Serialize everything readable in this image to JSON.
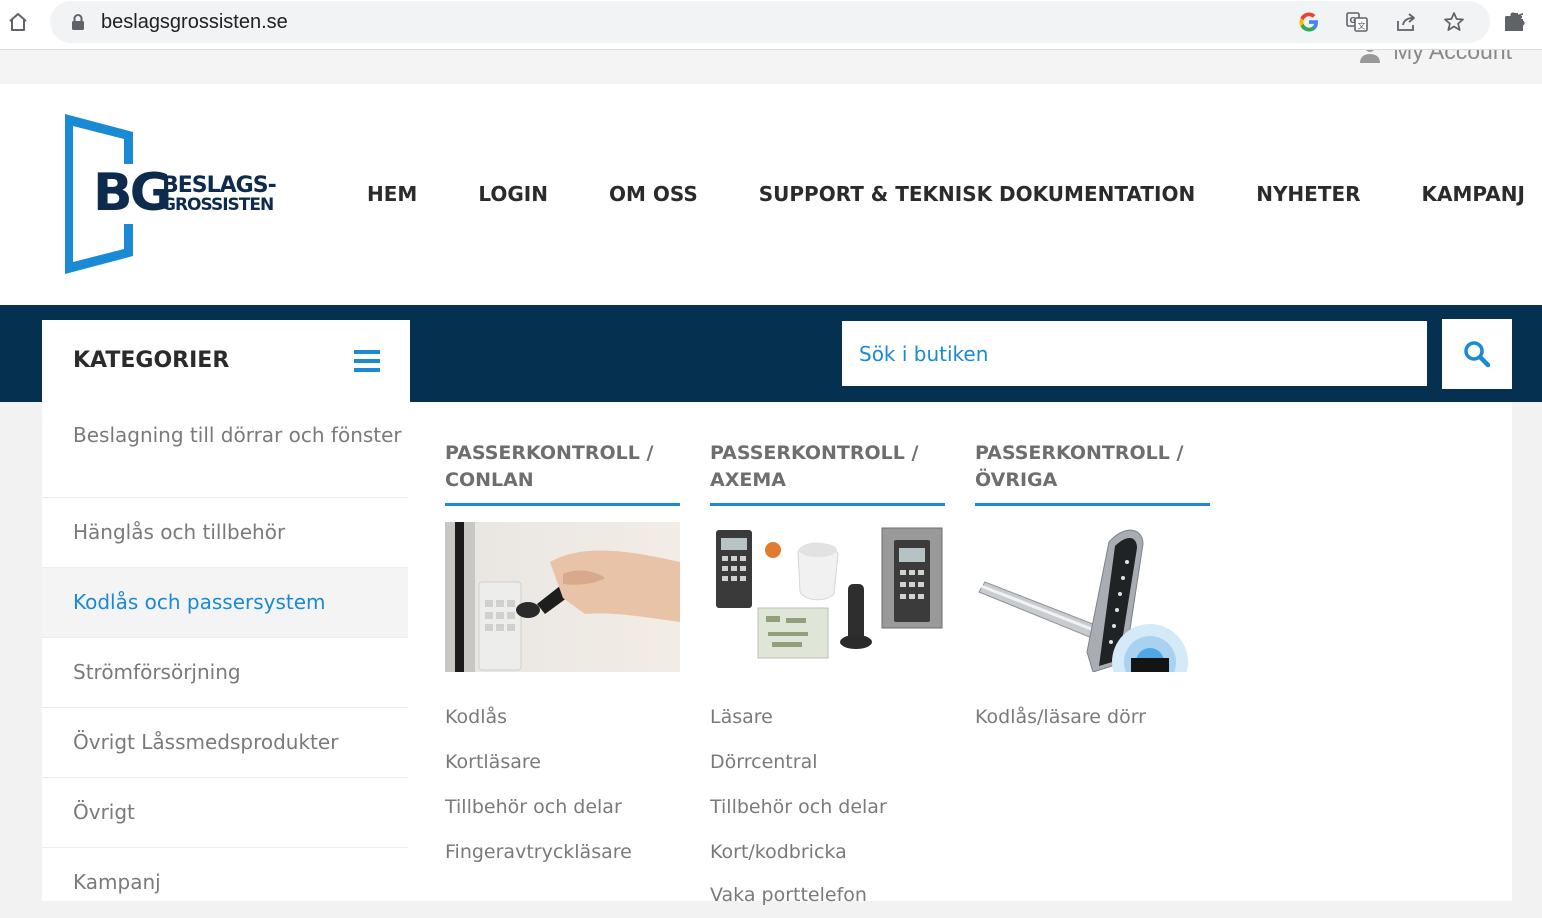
{
  "browser": {
    "url": "beslagsgrossisten.se",
    "icons": [
      "home-icon",
      "lock-icon",
      "google-icon",
      "translate-icon",
      "share-icon",
      "star-icon",
      "extensions-icon"
    ]
  },
  "topbar": {
    "account_label": "My Account"
  },
  "logo": {
    "initials": "BG",
    "line1": "BESLAGS-",
    "line2": "GROSSISTEN"
  },
  "nav": {
    "items": [
      "HEM",
      "LOGIN",
      "OM OSS",
      "SUPPORT & TEKNISK DOKUMENTATION",
      "NYHETER",
      "KAMPANJ"
    ]
  },
  "categories": {
    "title": "KATEGORIER",
    "items": [
      "Beslagning till dörrar och fönster",
      "Hänglås och tillbehör",
      "Kodlås och passersystem",
      "Strömförsörjning",
      "Övrigt Låssmedsprodukter",
      "Övrigt",
      "Kampanj"
    ],
    "active_index": 2
  },
  "search": {
    "placeholder": "Sök i butiken"
  },
  "mega_menu": {
    "columns": [
      {
        "title_line1": "PASSERKONTROLL /",
        "title_line2": "CONLAN",
        "links": [
          "Kodlås",
          "Kortläsare",
          "Tillbehör och delar",
          "Fingeravtryckläsare"
        ]
      },
      {
        "title_line1": "PASSERKONTROLL /",
        "title_line2": "AXEMA",
        "links": [
          "Läsare",
          "Dörrcentral",
          "Tillbehör och delar",
          "Kort/kodbricka",
          "Vaka porttelefon"
        ]
      },
      {
        "title_line1": "PASSERKONTROLL /",
        "title_line2": "ÖVRIGA",
        "links": [
          "Kodlås/läsare dörr"
        ]
      }
    ]
  },
  "colors": {
    "navy": "#06304f",
    "accent_blue": "#1a8ad4",
    "nav_text": "#2b2b2b",
    "muted_text": "#7a7a7a"
  }
}
